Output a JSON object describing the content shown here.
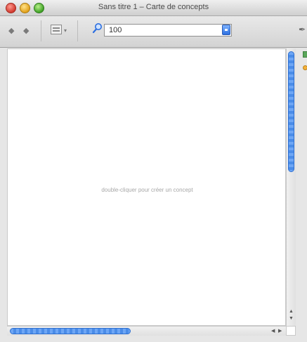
{
  "window": {
    "title": "Sans titre 1 – Carte de concepts"
  },
  "toolbar": {
    "back_icon": "back-arrow",
    "forward_icon": "forward-arrow",
    "layout_icon": "layout-menu",
    "zoom_icon": "magnifier",
    "zoom_value": "100"
  },
  "canvas": {
    "hint": "double-cliquer pour créer un concept"
  },
  "colors": {
    "accent": "#2c6fe0",
    "canvas_bg": "#ffffff",
    "hint_text": "#a7a7a7"
  }
}
